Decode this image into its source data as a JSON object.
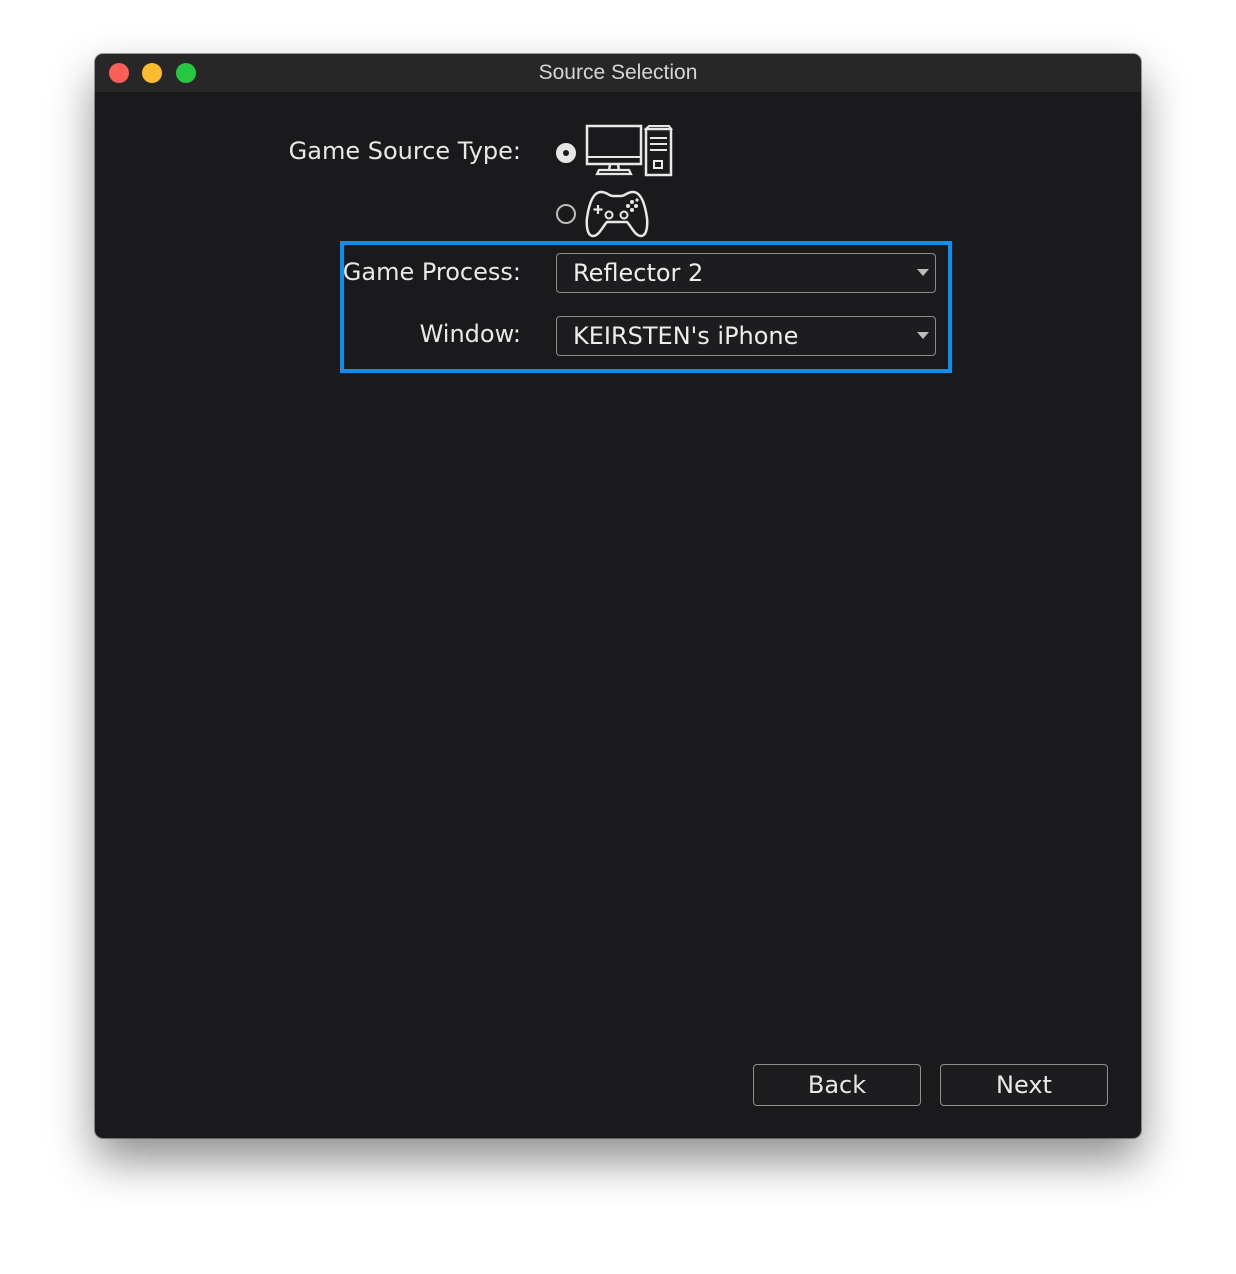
{
  "window": {
    "title": "Source Selection"
  },
  "form": {
    "source_type_label": "Game Source Type:",
    "source_options": [
      {
        "icon": "pc-icon",
        "selected": true
      },
      {
        "icon": "gamepad-icon",
        "selected": false
      }
    ],
    "process_label": "Game Process:",
    "process_value": "Reflector 2",
    "window_label": "Window:",
    "window_value": "KEIRSTEN's iPhone"
  },
  "buttons": {
    "back_label": "Back",
    "next_label": "Next"
  },
  "colors": {
    "highlight": "#0a8ff2",
    "background": "#1a1a1d"
  }
}
